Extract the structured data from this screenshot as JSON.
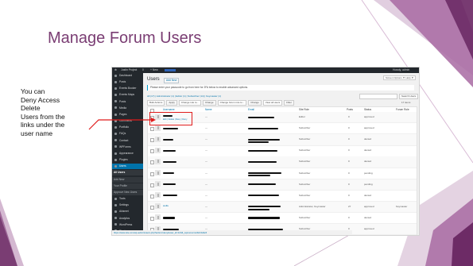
{
  "slide": {
    "title": "Manage Forum Users",
    "note_lines": [
      "You can",
      "Deny Access",
      "Delete",
      "Users from the",
      "links under the",
      "user name"
    ],
    "accent_color": "#7a3d73",
    "highlight_color": "#e01b1b"
  },
  "admin_bar": {
    "site": "Justin Project",
    "counter": "0",
    "new": "+ New",
    "greeting": "Howdy, admin"
  },
  "sidebar": {
    "items": [
      {
        "label": "Dashboard",
        "icon": "dashboard-icon"
      },
      {
        "label": "Posts",
        "icon": "pin-icon"
      },
      {
        "label": "Events Booker",
        "icon": "calendar-icon"
      },
      {
        "label": "Events Maps",
        "icon": "map-icon"
      },
      {
        "label": "Posts",
        "icon": "pin-icon"
      },
      {
        "label": "Media",
        "icon": "media-icon"
      },
      {
        "label": "Pages",
        "icon": "page-icon"
      },
      {
        "label": "Comments",
        "icon": "comment-icon"
      },
      {
        "label": "Portfolio",
        "icon": "portfolio-icon"
      },
      {
        "label": "FAQs",
        "icon": "faq-icon"
      },
      {
        "label": "Contact",
        "icon": "mail-icon"
      },
      {
        "label": "WPForms",
        "icon": "form-icon"
      },
      {
        "label": "Appearance",
        "icon": "brush-icon"
      },
      {
        "label": "Plugins",
        "icon": "plugin-icon"
      },
      {
        "label": "Users",
        "icon": "users-icon",
        "active": true
      },
      {
        "label": "All Users",
        "sub": true,
        "current": true
      },
      {
        "label": "Add New",
        "sub": true
      },
      {
        "label": "Your Profile",
        "sub": true
      },
      {
        "label": "Approve New Users",
        "sub": true
      },
      {
        "label": "Tools",
        "icon": "wrench-icon"
      },
      {
        "label": "Settings",
        "icon": "settings-icon"
      },
      {
        "label": "Akismet",
        "icon": "shield-icon"
      },
      {
        "label": "Analytics",
        "icon": "chart-icon"
      },
      {
        "label": "WordPress",
        "icon": "wp-icon"
      },
      {
        "label": "Plugins",
        "icon": "plugin-icon"
      }
    ]
  },
  "page": {
    "heading": "Users",
    "add_new": "Add New",
    "screen_options": "Screen Options ▼  Help ▼",
    "notice": "Please enter your passcode to go from here for 2FA below to enable advanced options.",
    "filters": "All (17) | Administrator (1) | Editor (1) | Subscriber (14) | Keymaster (1)",
    "search_button": "Search Users",
    "bulk_actions": "Bulk Actions",
    "apply": "Apply",
    "change_role": "Change role to...",
    "change": "Change",
    "forum_role": "Change forum role to...",
    "change2": "Change",
    "view_all": "View all users",
    "filter": "Filter",
    "item_count": "17 items"
  },
  "table": {
    "columns": [
      "Username",
      "Name",
      "Email",
      "Site Role",
      "Posts",
      "Status",
      "Forum Role"
    ],
    "row_actions": "Edit | Delete | Deny | Deny",
    "rows": [
      {
        "name": "—",
        "role": "Editor",
        "posts": "0",
        "status": "approved",
        "forum": ""
      },
      {
        "name": "—",
        "role": "Subscriber",
        "posts": "0",
        "status": "approved",
        "forum": ""
      },
      {
        "name": "—",
        "role": "Subscriber",
        "posts": "0",
        "status": "denied",
        "forum": ""
      },
      {
        "name": "—",
        "role": "Subscriber",
        "posts": "0",
        "status": "denied",
        "forum": ""
      },
      {
        "name": "—",
        "role": "Subscriber",
        "posts": "0",
        "status": "denied",
        "forum": ""
      },
      {
        "name": "—",
        "role": "Subscriber",
        "posts": "0",
        "status": "pending",
        "forum": ""
      },
      {
        "name": "—",
        "role": "Subscriber",
        "posts": "0",
        "status": "pending",
        "forum": ""
      },
      {
        "name": "—",
        "role": "Subscriber",
        "posts": "0",
        "status": "denied",
        "forum": ""
      },
      {
        "name": "—",
        "role": "Administrator, Keymaster",
        "posts": "27",
        "status": "approved",
        "forum": "Keymaster",
        "username": "wolfe"
      },
      {
        "name": "—",
        "role": "Subscriber",
        "posts": "0",
        "status": "denied",
        "forum": ""
      },
      {
        "name": "—",
        "role": "Subscriber",
        "posts": "0",
        "status": "approved",
        "forum": ""
      }
    ]
  },
  "status_url": "https://www.site.com/wp-admin/users.php?action=deny&user_id=123&_wpnonce=a1b2c3d4e5"
}
